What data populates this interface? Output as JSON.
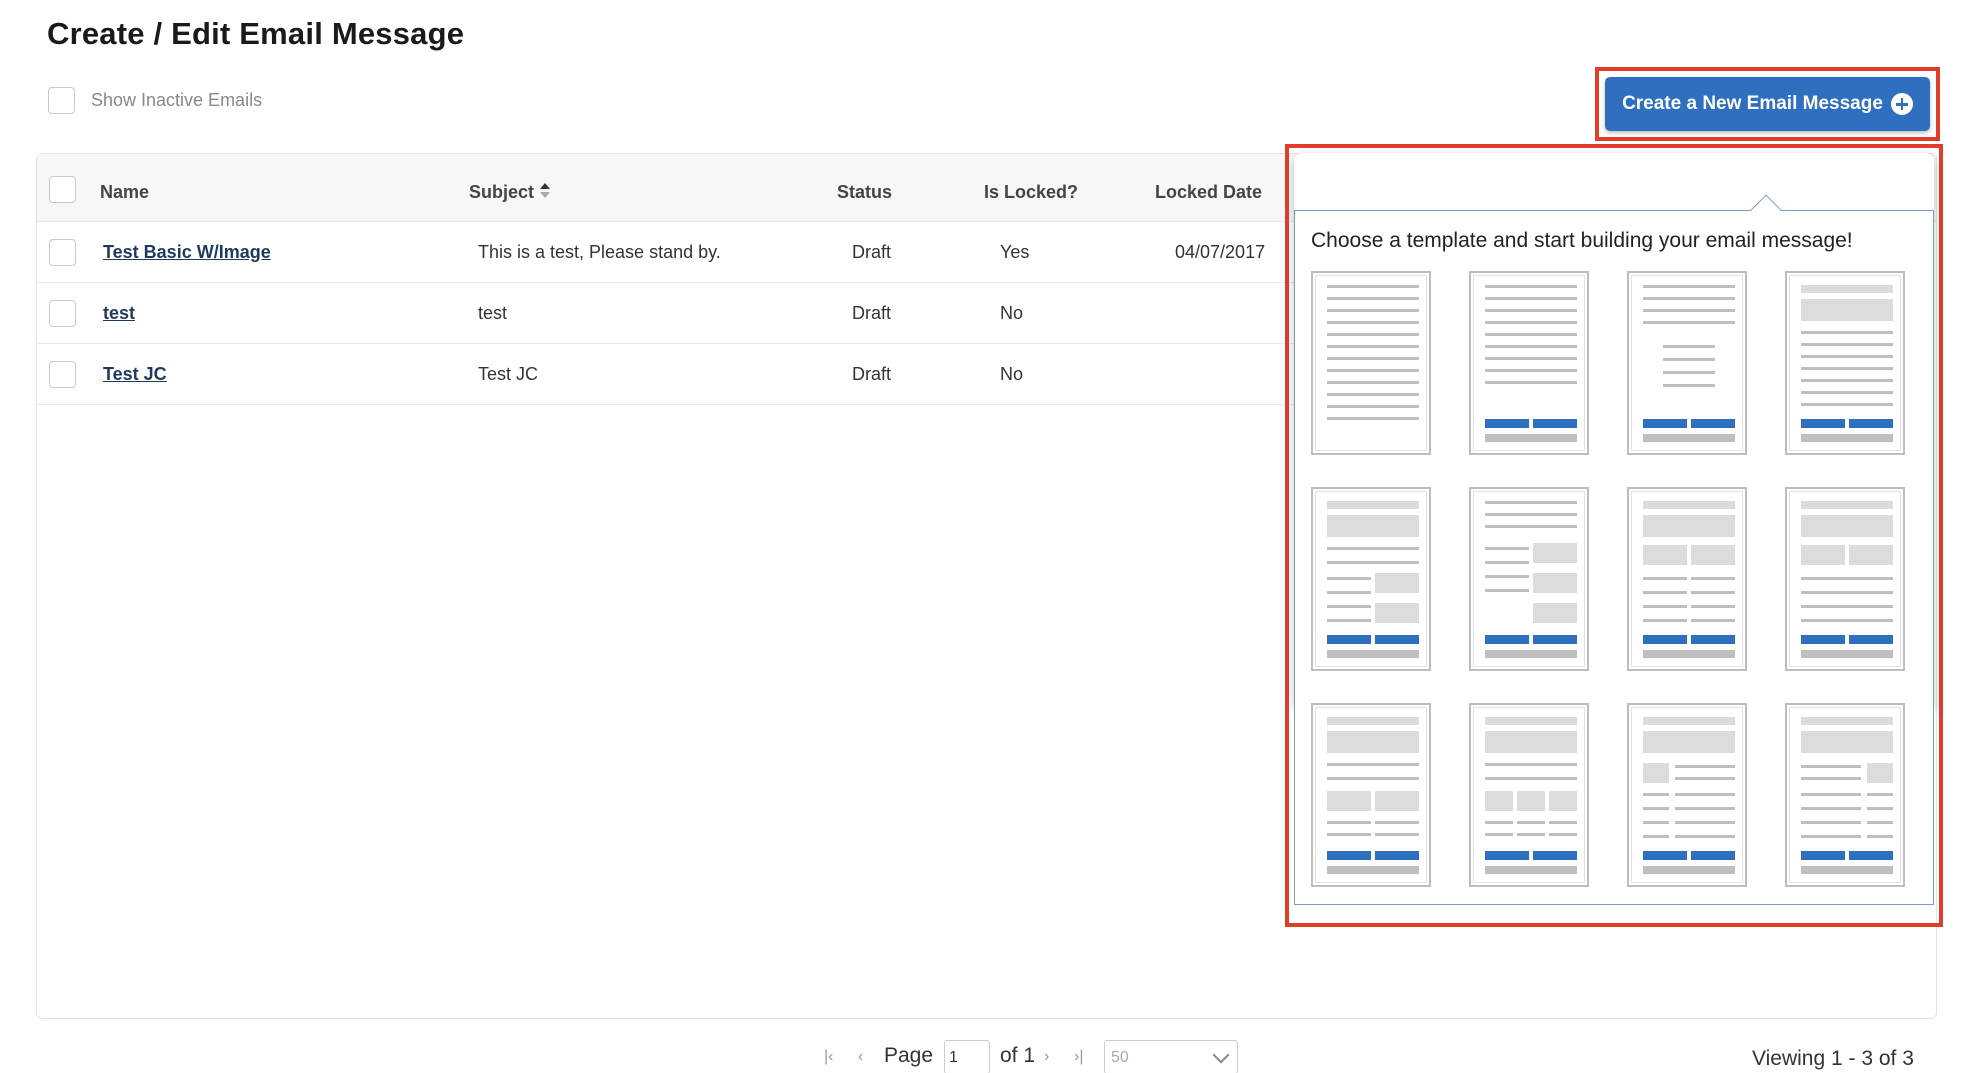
{
  "page": {
    "title": "Create / Edit Email Message"
  },
  "filters": {
    "show_inactive_label": "Show Inactive Emails"
  },
  "toolbar": {
    "create_label": "Create a New Email Message"
  },
  "table": {
    "columns": [
      {
        "label": "Name"
      },
      {
        "label": "Subject"
      },
      {
        "label": "Status"
      },
      {
        "label": "Is Locked?"
      },
      {
        "label": "Locked Date"
      }
    ],
    "rows": [
      {
        "name": "Test Basic W/Image",
        "subject": "This is a test, Please stand by.",
        "status": "Draft",
        "locked": "Yes",
        "locked_date": "04/07/2017"
      },
      {
        "name": "test",
        "subject": "test",
        "status": "Draft",
        "locked": "No",
        "locked_date": ""
      },
      {
        "name": "Test JC",
        "subject": "Test JC",
        "status": "Draft",
        "locked": "No",
        "locked_date": ""
      }
    ]
  },
  "template_picker": {
    "title": "Choose a template and start building your email message!",
    "templates": [
      "template-1",
      "template-2",
      "template-3",
      "template-4",
      "template-5",
      "template-6",
      "template-7",
      "template-8",
      "template-9",
      "template-10",
      "template-11",
      "template-12"
    ]
  },
  "pagination": {
    "page_label": "Page",
    "current_page": "1",
    "of_label": "of 1",
    "page_size": "50",
    "viewing": "Viewing 1 - 3 of 3"
  },
  "colors": {
    "accent": "#2f6fbf",
    "highlight": "#e03e2a",
    "link": "#1e3a5f"
  },
  "icons": {
    "create": "plus-circle-icon",
    "sort": "sort-icon"
  }
}
